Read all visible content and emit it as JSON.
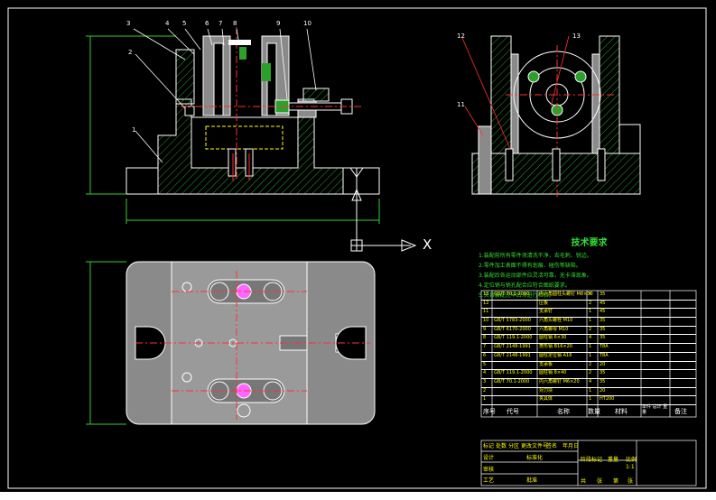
{
  "colors": {
    "background": "#000000",
    "outline": "#ffffff",
    "centerline": "#ff3030",
    "hatch": "#2ca02c",
    "dimension": "#33cc33",
    "part_fill": "#8a8a8a",
    "note_text": "#33dd33",
    "title_text": "#ffff00",
    "callout_line": "#ff3030"
  },
  "part_callouts": [
    "1",
    "2",
    "3",
    "4",
    "5",
    "6",
    "7",
    "8",
    "9",
    "10",
    "11",
    "12",
    "13"
  ],
  "axis_marker": "X",
  "technical_requirements": {
    "heading": "技术要求",
    "lines": [
      "1.装配前所有零件须清洗干净，去毛刺、锐边。",
      "2.零件加工表面不得有划痕、碰伤等缺陷。",
      "3.装配后各运动部件应灵活可靠，无卡滞现象。",
      "4.定位销与销孔配合应符合图纸要求。",
      "5.夹具装配完毕后须进行检验。"
    ]
  },
  "bom_rows": [
    {
      "no": "13",
      "code": "GB/T 70.1-2000",
      "name": "内六角圆柱头螺钉 M8×30",
      "qty": "4",
      "material": "35"
    },
    {
      "no": "12",
      "code": "",
      "name": "压板",
      "qty": "2",
      "material": "45"
    },
    {
      "no": "11",
      "code": "",
      "name": "支承钉",
      "qty": "1",
      "material": "45"
    },
    {
      "no": "10",
      "code": "GB/T 5783-2000",
      "name": "六角头螺栓 M10",
      "qty": "1",
      "material": "35"
    },
    {
      "no": "9",
      "code": "GB/T 6170-2000",
      "name": "六角螺母 M10",
      "qty": "2",
      "material": "35"
    },
    {
      "no": "8",
      "code": "GB/T 119.1-2000",
      "name": "圆柱销 6×30",
      "qty": "4",
      "material": "35"
    },
    {
      "no": "7",
      "code": "GB/T 2148-1991",
      "name": "菱形销 B16×20",
      "qty": "1",
      "material": "T8A"
    },
    {
      "no": "6",
      "code": "GB/T 2148-1991",
      "name": "圆柱定位销 A16",
      "qty": "1",
      "material": "T8A"
    },
    {
      "no": "5",
      "code": "",
      "name": "支承板",
      "qty": "2",
      "material": "20"
    },
    {
      "no": "4",
      "code": "GB/T 119.1-2000",
      "name": "圆柱销 8×40",
      "qty": "2",
      "material": "35"
    },
    {
      "no": "3",
      "code": "GB/T 70.1-2000",
      "name": "内六角螺钉 M6×20",
      "qty": "4",
      "material": "35"
    },
    {
      "no": "2",
      "code": "",
      "name": "对刀块",
      "qty": "1",
      "material": "20"
    },
    {
      "no": "1",
      "code": "",
      "name": "夹具体",
      "qty": "1",
      "material": "HT200"
    }
  ],
  "bom_header": {
    "no": "序号",
    "code": "代号",
    "name": "名称",
    "qty": "数量",
    "material": "材料",
    "weight": "单件 总计 重量",
    "remark": "备注"
  },
  "title_block": {
    "labels": [
      "标记",
      "处数",
      "分区",
      "更改文件号",
      "签名",
      "年月日",
      "设计",
      "标准化",
      "审核",
      "工艺",
      "批准"
    ],
    "stage_labels": [
      "阶段标记",
      "重量",
      "比例"
    ],
    "scale": "1:1",
    "sheet": [
      "共",
      "张",
      "第",
      "张"
    ]
  }
}
